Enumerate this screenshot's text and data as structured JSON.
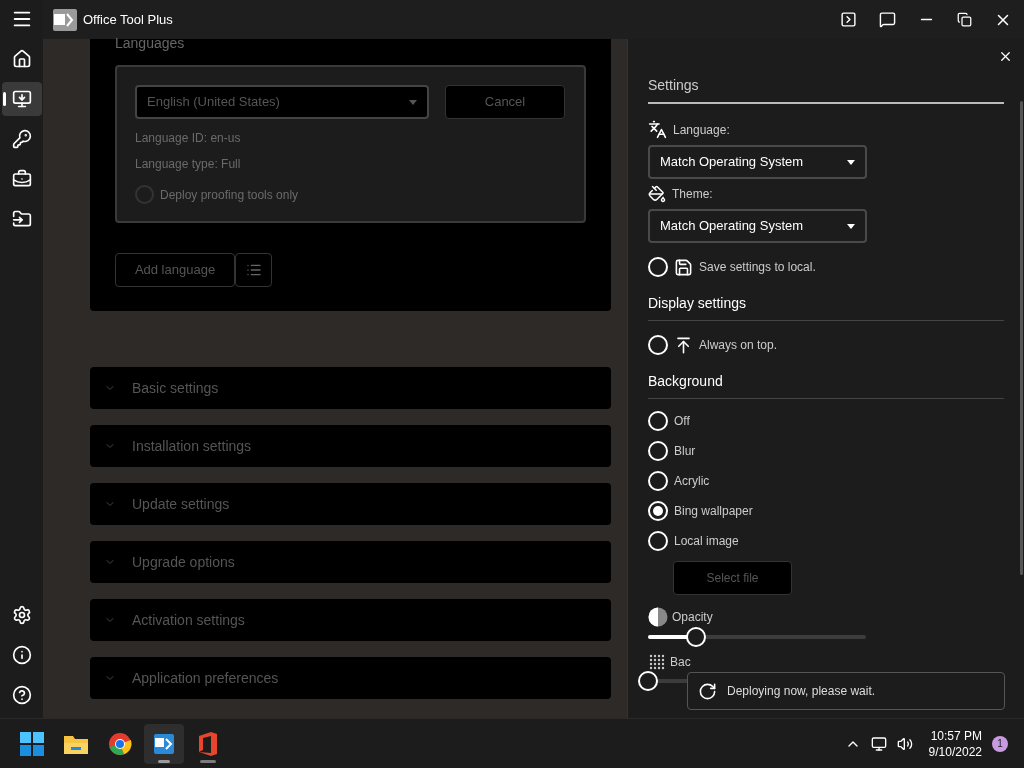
{
  "window": {
    "title": "Office Tool Plus"
  },
  "sidebar": {
    "items": [
      {
        "kind": "home",
        "selected": false
      },
      {
        "kind": "deploy",
        "selected": true
      },
      {
        "kind": "activate",
        "selected": false
      },
      {
        "kind": "toolbox",
        "selected": false
      },
      {
        "kind": "convert",
        "selected": false
      }
    ],
    "bottom_items": [
      {
        "kind": "settings",
        "selected": false
      },
      {
        "kind": "about",
        "selected": false
      },
      {
        "kind": "help",
        "selected": false
      }
    ]
  },
  "languages_card": {
    "title": "Languages",
    "language_select": "English (United States)",
    "cancel_button": "Cancel",
    "language_id": "Language ID: en-us",
    "language_type": "Language type: Full",
    "proofing_option": {
      "label": "Deploy proofing tools only",
      "checked": false
    },
    "add_button": "Add language"
  },
  "sections": [
    {
      "label": "Basic settings",
      "expanded": false
    },
    {
      "label": "Installation settings",
      "expanded": false
    },
    {
      "label": "Update settings",
      "expanded": false
    },
    {
      "label": "Upgrade options",
      "expanded": false
    },
    {
      "label": "Activation settings",
      "expanded": false
    },
    {
      "label": "Application preferences",
      "expanded": false
    }
  ],
  "settings_panel": {
    "title": "Settings",
    "language": {
      "label": "Language:",
      "value": "Match Operating System"
    },
    "theme": {
      "label": "Theme:",
      "value": "Match Operating System"
    },
    "save_local": {
      "label": "Save settings to local.",
      "checked": false
    },
    "display_heading": "Display settings",
    "always_on_top": {
      "label": "Always on top.",
      "checked": false
    },
    "background_heading": "Background",
    "background_options": [
      {
        "label": "Off",
        "selected": false
      },
      {
        "label": "Blur",
        "selected": false
      },
      {
        "label": "Acrylic",
        "selected": false
      },
      {
        "label": "Bing wallpaper",
        "selected": true
      },
      {
        "label": "Local image",
        "selected": false
      }
    ],
    "select_file_button": "Select file",
    "opacity": {
      "label": "Opacity",
      "level": 0.22
    },
    "blur": {
      "label": "Bac",
      "level": 0
    }
  },
  "toast": {
    "message": "Deploying now, please wait."
  },
  "taskbar": {
    "apps": [
      {
        "kind": "start",
        "selected": false,
        "running": false
      },
      {
        "kind": "files",
        "selected": false,
        "running": false
      },
      {
        "kind": "browser",
        "selected": false,
        "running": false
      },
      {
        "kind": "tool",
        "selected": true,
        "running": true
      },
      {
        "kind": "office",
        "selected": false,
        "running": true
      }
    ],
    "time": "10:57 PM",
    "date": "9/10/2022",
    "notification_count": "1"
  }
}
